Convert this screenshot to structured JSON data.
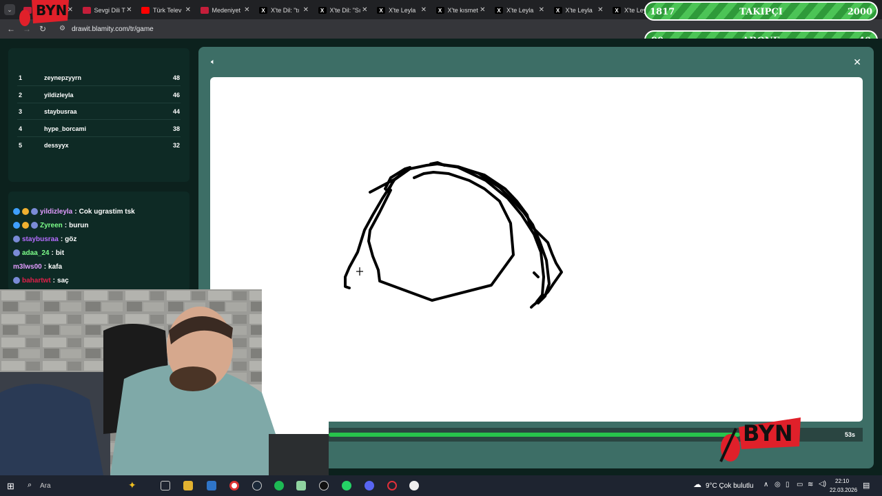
{
  "browser": {
    "tabs": [
      {
        "title": "",
        "color": "#c41e3a"
      },
      {
        "title": "Sevgi Dili T",
        "color": "#c41e3a"
      },
      {
        "title": "Türk Telev",
        "color": "#ff0000"
      },
      {
        "title": "Medeniyet",
        "color": "#c41e3a"
      },
      {
        "title": "X'te Dil: \"tı",
        "color": "#000000"
      },
      {
        "title": "X'te Dil: \"Sı",
        "color": "#000000"
      },
      {
        "title": "X'te Leyla",
        "color": "#000000"
      },
      {
        "title": "X'te kısmet",
        "color": "#000000"
      },
      {
        "title": "X'te Leyla",
        "color": "#000000"
      },
      {
        "title": "X'te Leyla",
        "color": "#000000"
      },
      {
        "title": "X'te Leyl",
        "color": "#000000"
      }
    ],
    "url": "drawit.blamity.com/tr/game"
  },
  "overlay": {
    "followers": {
      "current": "1817",
      "label": "TAKIPÇI",
      "goal": "2000",
      "progress": 0.9085
    },
    "subscribers": {
      "current": "90",
      "label": "ABONE",
      "goal": "40"
    },
    "logo_text": "BYN"
  },
  "leaderboard": [
    {
      "rank": "1",
      "name": "zeynepzyyrn",
      "score": "48"
    },
    {
      "rank": "2",
      "name": "yildizleyla",
      "score": "46"
    },
    {
      "rank": "3",
      "name": "staybusraa",
      "score": "44"
    },
    {
      "rank": "4",
      "name": "hype_borcami",
      "score": "38"
    },
    {
      "rank": "5",
      "name": "dessyyx",
      "score": "32"
    }
  ],
  "chat": [
    {
      "user": "yildizleyla",
      "message": "Cok ugrastim tsk",
      "color": "#e29cff"
    },
    {
      "user": "Zyreen",
      "message": "burun",
      "color": "#7dff8a"
    },
    {
      "user": "staybusraa",
      "message": "göz",
      "color": "#b56cff"
    },
    {
      "user": "adaa_24",
      "message": "bit",
      "color": "#7dff8a"
    },
    {
      "user": "m3lws00",
      "message": "kafa",
      "color": "#e29cff"
    },
    {
      "user": "bahartwt",
      "message": "saç",
      "color": "#e0204a"
    }
  ],
  "game": {
    "timer": "53s",
    "time_remaining_fraction": 0.77,
    "accent": "#27c44c"
  },
  "taskbar": {
    "search_placeholder": "Ara",
    "weather": "9°C  Çok bulutlu",
    "time": "22:10",
    "date": "22.03.2026"
  }
}
